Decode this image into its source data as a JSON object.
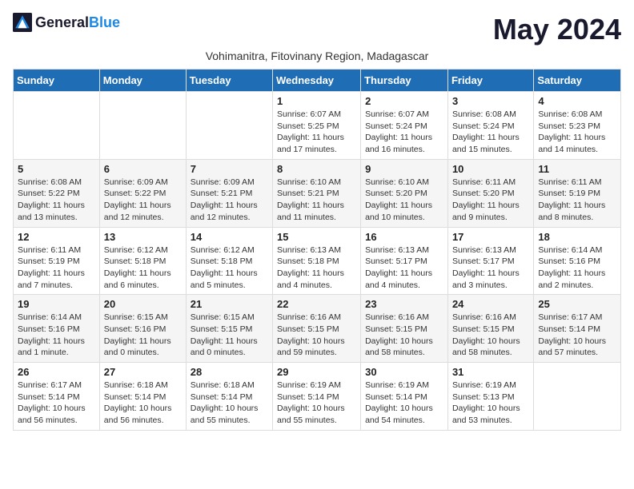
{
  "header": {
    "logo_general": "General",
    "logo_blue": "Blue",
    "month_year": "May 2024",
    "subtitle": "Vohimanitra, Fitovinany Region, Madagascar"
  },
  "weekdays": [
    "Sunday",
    "Monday",
    "Tuesday",
    "Wednesday",
    "Thursday",
    "Friday",
    "Saturday"
  ],
  "weeks": [
    [
      {
        "day": "",
        "info": ""
      },
      {
        "day": "",
        "info": ""
      },
      {
        "day": "",
        "info": ""
      },
      {
        "day": "1",
        "info": "Sunrise: 6:07 AM\nSunset: 5:25 PM\nDaylight: 11 hours and 17 minutes."
      },
      {
        "day": "2",
        "info": "Sunrise: 6:07 AM\nSunset: 5:24 PM\nDaylight: 11 hours and 16 minutes."
      },
      {
        "day": "3",
        "info": "Sunrise: 6:08 AM\nSunset: 5:24 PM\nDaylight: 11 hours and 15 minutes."
      },
      {
        "day": "4",
        "info": "Sunrise: 6:08 AM\nSunset: 5:23 PM\nDaylight: 11 hours and 14 minutes."
      }
    ],
    [
      {
        "day": "5",
        "info": "Sunrise: 6:08 AM\nSunset: 5:22 PM\nDaylight: 11 hours and 13 minutes."
      },
      {
        "day": "6",
        "info": "Sunrise: 6:09 AM\nSunset: 5:22 PM\nDaylight: 11 hours and 12 minutes."
      },
      {
        "day": "7",
        "info": "Sunrise: 6:09 AM\nSunset: 5:21 PM\nDaylight: 11 hours and 12 minutes."
      },
      {
        "day": "8",
        "info": "Sunrise: 6:10 AM\nSunset: 5:21 PM\nDaylight: 11 hours and 11 minutes."
      },
      {
        "day": "9",
        "info": "Sunrise: 6:10 AM\nSunset: 5:20 PM\nDaylight: 11 hours and 10 minutes."
      },
      {
        "day": "10",
        "info": "Sunrise: 6:11 AM\nSunset: 5:20 PM\nDaylight: 11 hours and 9 minutes."
      },
      {
        "day": "11",
        "info": "Sunrise: 6:11 AM\nSunset: 5:19 PM\nDaylight: 11 hours and 8 minutes."
      }
    ],
    [
      {
        "day": "12",
        "info": "Sunrise: 6:11 AM\nSunset: 5:19 PM\nDaylight: 11 hours and 7 minutes."
      },
      {
        "day": "13",
        "info": "Sunrise: 6:12 AM\nSunset: 5:18 PM\nDaylight: 11 hours and 6 minutes."
      },
      {
        "day": "14",
        "info": "Sunrise: 6:12 AM\nSunset: 5:18 PM\nDaylight: 11 hours and 5 minutes."
      },
      {
        "day": "15",
        "info": "Sunrise: 6:13 AM\nSunset: 5:18 PM\nDaylight: 11 hours and 4 minutes."
      },
      {
        "day": "16",
        "info": "Sunrise: 6:13 AM\nSunset: 5:17 PM\nDaylight: 11 hours and 4 minutes."
      },
      {
        "day": "17",
        "info": "Sunrise: 6:13 AM\nSunset: 5:17 PM\nDaylight: 11 hours and 3 minutes."
      },
      {
        "day": "18",
        "info": "Sunrise: 6:14 AM\nSunset: 5:16 PM\nDaylight: 11 hours and 2 minutes."
      }
    ],
    [
      {
        "day": "19",
        "info": "Sunrise: 6:14 AM\nSunset: 5:16 PM\nDaylight: 11 hours and 1 minute."
      },
      {
        "day": "20",
        "info": "Sunrise: 6:15 AM\nSunset: 5:16 PM\nDaylight: 11 hours and 0 minutes."
      },
      {
        "day": "21",
        "info": "Sunrise: 6:15 AM\nSunset: 5:15 PM\nDaylight: 11 hours and 0 minutes."
      },
      {
        "day": "22",
        "info": "Sunrise: 6:16 AM\nSunset: 5:15 PM\nDaylight: 10 hours and 59 minutes."
      },
      {
        "day": "23",
        "info": "Sunrise: 6:16 AM\nSunset: 5:15 PM\nDaylight: 10 hours and 58 minutes."
      },
      {
        "day": "24",
        "info": "Sunrise: 6:16 AM\nSunset: 5:15 PM\nDaylight: 10 hours and 58 minutes."
      },
      {
        "day": "25",
        "info": "Sunrise: 6:17 AM\nSunset: 5:14 PM\nDaylight: 10 hours and 57 minutes."
      }
    ],
    [
      {
        "day": "26",
        "info": "Sunrise: 6:17 AM\nSunset: 5:14 PM\nDaylight: 10 hours and 56 minutes."
      },
      {
        "day": "27",
        "info": "Sunrise: 6:18 AM\nSunset: 5:14 PM\nDaylight: 10 hours and 56 minutes."
      },
      {
        "day": "28",
        "info": "Sunrise: 6:18 AM\nSunset: 5:14 PM\nDaylight: 10 hours and 55 minutes."
      },
      {
        "day": "29",
        "info": "Sunrise: 6:19 AM\nSunset: 5:14 PM\nDaylight: 10 hours and 55 minutes."
      },
      {
        "day": "30",
        "info": "Sunrise: 6:19 AM\nSunset: 5:14 PM\nDaylight: 10 hours and 54 minutes."
      },
      {
        "day": "31",
        "info": "Sunrise: 6:19 AM\nSunset: 5:13 PM\nDaylight: 10 hours and 53 minutes."
      },
      {
        "day": "",
        "info": ""
      }
    ]
  ]
}
